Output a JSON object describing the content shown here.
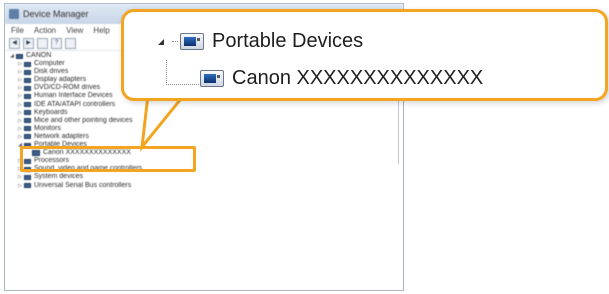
{
  "window": {
    "title": "Device Manager",
    "menus": [
      "File",
      "Action",
      "View",
      "Help"
    ]
  },
  "tree": {
    "root": "CANON",
    "items": [
      {
        "label": "Computer",
        "icon": "computer-icon"
      },
      {
        "label": "Disk drives",
        "icon": "disk-icon"
      },
      {
        "label": "Display adapters",
        "icon": "display-icon"
      },
      {
        "label": "DVD/CD-ROM drives",
        "icon": "dvd-icon"
      },
      {
        "label": "Human Interface Devices",
        "icon": "hid-icon"
      },
      {
        "label": "IDE ATA/ATAPI controllers",
        "icon": "ide-icon"
      },
      {
        "label": "Keyboards",
        "icon": "keyboard-icon"
      },
      {
        "label": "Mice and other pointing devices",
        "icon": "mouse-icon"
      },
      {
        "label": "Monitors",
        "icon": "monitor-icon"
      },
      {
        "label": "Network adapters",
        "icon": "network-icon"
      },
      {
        "label": "Portable Devices",
        "icon": "portable-device-icon",
        "expanded": true,
        "children": [
          {
            "label": "Canon XXXXXXXXXXXXXX"
          }
        ]
      },
      {
        "label": "Processors",
        "icon": "processor-icon"
      },
      {
        "label": "Sound, video and game controllers",
        "icon": "sound-icon"
      },
      {
        "label": "System devices",
        "icon": "system-icon"
      },
      {
        "label": "Universal Serial Bus controllers",
        "icon": "usb-icon"
      }
    ]
  },
  "callout": {
    "category_label": "Portable Devices",
    "device_label": "Canon XXXXXXXXXXXXXX"
  },
  "colors": {
    "highlight": "#f3a521",
    "icon_blue": "#2d6fc0"
  }
}
